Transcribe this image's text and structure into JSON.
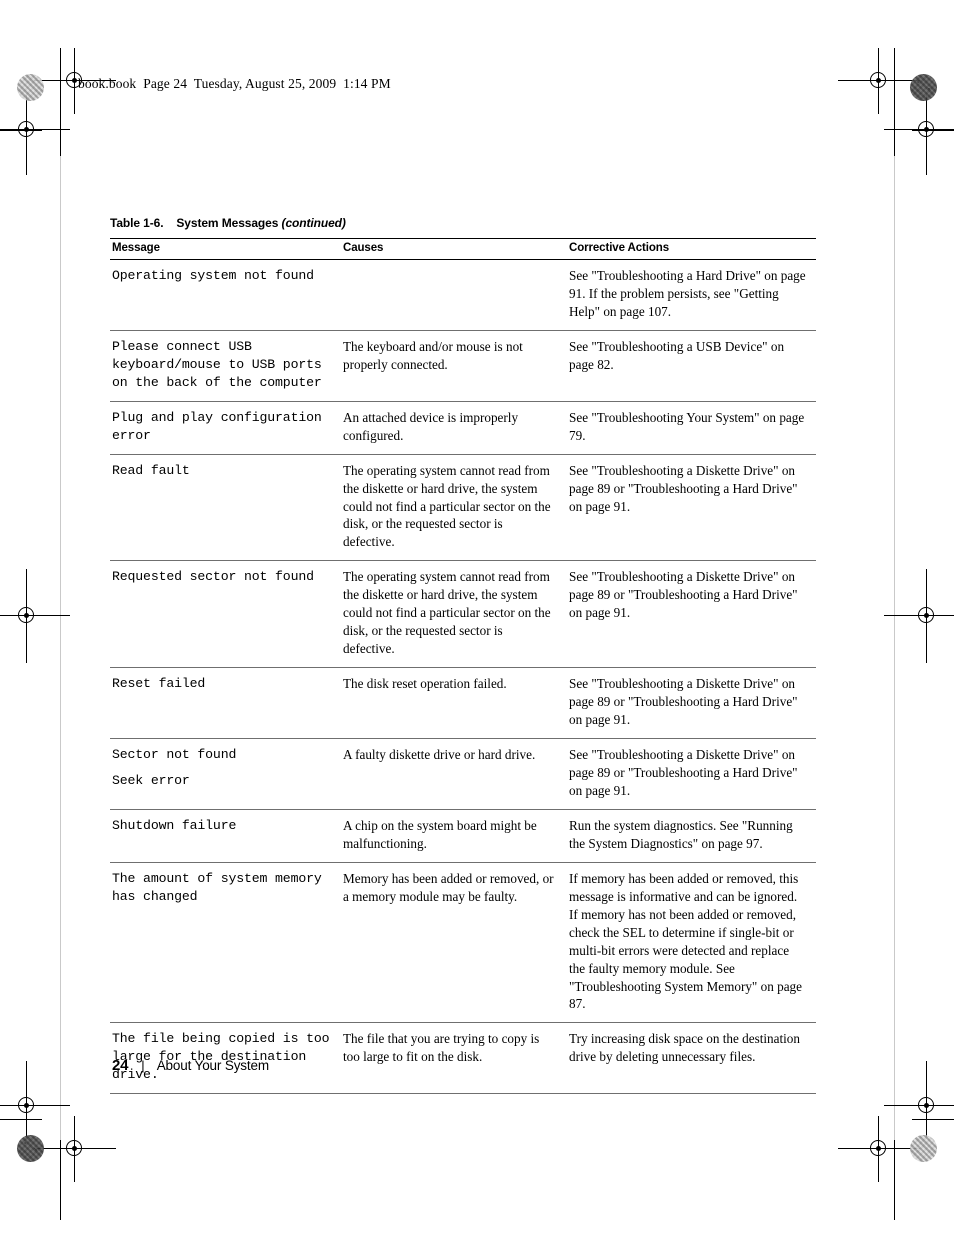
{
  "running_header": "book.book  Page 24  Tuesday, August 25, 2009  1:14 PM",
  "table": {
    "caption_number": "Table 1-6.",
    "caption_title": "System Messages",
    "caption_continued": "(continued)",
    "columns": [
      "Message",
      "Causes",
      "Corrective Actions"
    ],
    "rows": [
      {
        "message": "Operating system not found",
        "message_line2": "",
        "cause": "",
        "corrective": "See \"Troubleshooting a Hard Drive\" on page 91. If the problem persists, see \"Getting Help\" on page 107."
      },
      {
        "message": "Please connect USB keyboard/mouse to USB ports on the back of the computer",
        "message_line2": "",
        "cause": "The keyboard and/or mouse is not properly connected.",
        "corrective": "See \"Troubleshooting a USB Device\" on page 82."
      },
      {
        "message": "Plug and play configuration error",
        "message_line2": "",
        "cause": "An attached device is improperly configured.",
        "corrective": "See \"Troubleshooting Your System\" on page 79."
      },
      {
        "message": "Read fault",
        "message_line2": "",
        "cause": "The operating system cannot read from the diskette or hard drive, the system could not find a particular sector on the disk, or the requested sector is defective.",
        "corrective": "See \"Troubleshooting a Diskette Drive\" on page 89 or \"Troubleshooting a Hard Drive\" on page 91."
      },
      {
        "message": "Requested sector not found",
        "message_line2": "",
        "cause": "The operating system cannot read from the diskette or hard drive, the system could not find a particular sector on the disk, or the requested sector is defective.",
        "corrective": "See \"Troubleshooting a Diskette Drive\" on page 89 or \"Troubleshooting a Hard Drive\" on page 91."
      },
      {
        "message": "Reset failed",
        "message_line2": "",
        "cause": "The disk reset operation failed.",
        "corrective": "See \"Troubleshooting a Diskette Drive\" on page 89 or \"Troubleshooting a Hard Drive\" on page 91."
      },
      {
        "message": "Sector not found",
        "message_line2": "Seek error",
        "cause": "A faulty diskette drive or hard drive.",
        "corrective": "See \"Troubleshooting a Diskette Drive\" on page 89 or \"Troubleshooting a Hard Drive\" on page 91."
      },
      {
        "message": "Shutdown failure",
        "message_line2": "",
        "cause": "A chip on the system board might be malfunctioning.",
        "corrective": "Run the system diagnostics. See \"Running the System Diagnostics\" on page 97."
      },
      {
        "message": "The amount of system memory has changed",
        "message_line2": "",
        "cause": "Memory has been added or removed, or a memory module may be faulty.",
        "corrective": "If memory has been added or removed, this message is informative and can be ignored. If memory has not been added or removed, check the SEL to determine if single-bit or multi-bit errors were detected and replace the faulty memory module. See \"Troubleshooting System Memory\" on page 87."
      },
      {
        "message": "The file being copied is too large for the destination drive.",
        "message_line2": "",
        "cause": "The file that you are trying to copy is too large to fit on the disk.",
        "corrective": "Try increasing disk space on the destination drive by deleting unnecessary files."
      }
    ]
  },
  "footer": {
    "page_number": "24",
    "separator": "|",
    "section": "About Your System"
  }
}
